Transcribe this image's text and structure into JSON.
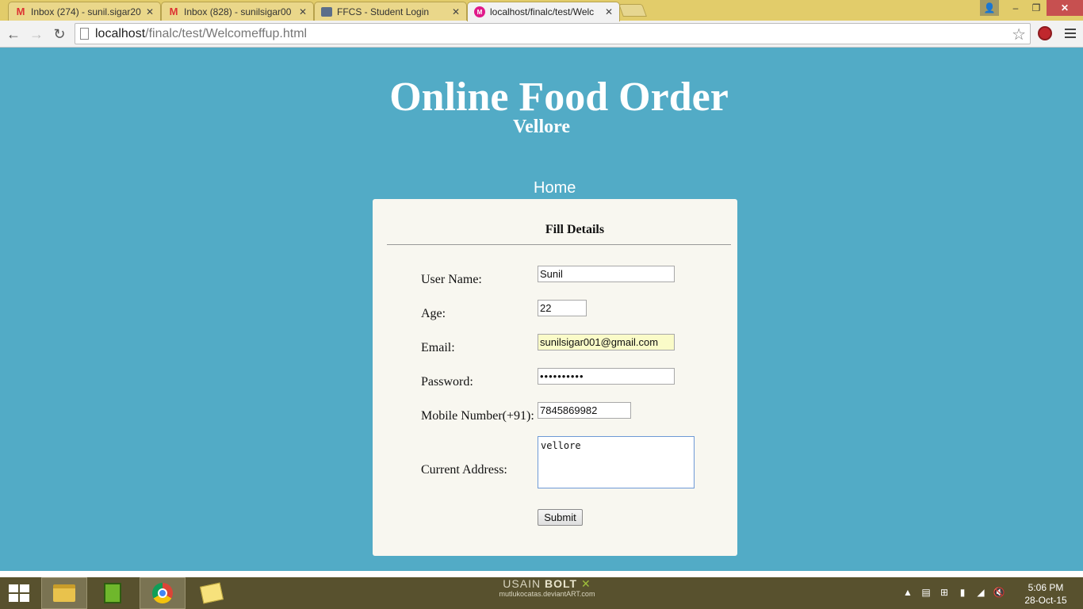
{
  "browser": {
    "tabs": [
      {
        "title": "Inbox (274) - sunil.sigar20",
        "icon": "gmail-icon"
      },
      {
        "title": "Inbox (828) - sunilsigar00",
        "icon": "gmail-icon"
      },
      {
        "title": "FFCS - Student Login",
        "icon": "ffcs-icon"
      },
      {
        "title": "localhost/finalc/test/Welc",
        "icon": "localhost-icon",
        "active": true
      }
    ],
    "tab_close_glyph": "✕",
    "url_host": "localhost",
    "url_path": "/finalc/test/Welcomeffup.html"
  },
  "page": {
    "title": "Online Food Order",
    "subtitle": "Vellore",
    "nav_home": "Home",
    "background_color": "#52abc6"
  },
  "form": {
    "heading": "Fill Details",
    "fields": {
      "username": {
        "label": "User Name:",
        "value": "Sunil"
      },
      "age": {
        "label": "Age:",
        "value": "22"
      },
      "email": {
        "label": "Email:",
        "value": "sunilsigar001@gmail.com"
      },
      "password": {
        "label": "Password:",
        "value": "••••••••••"
      },
      "mobile": {
        "label": "Mobile Number(+91):",
        "value": "7845869982"
      },
      "address": {
        "label": "Current Address:",
        "value": "vellore"
      }
    },
    "submit_label": "Submit"
  },
  "taskbar": {
    "wallpaper_line1": "USAIN",
    "wallpaper_line1_bold": "BOLT",
    "wallpaper_line2": "mutlukocatas.deviantART.com",
    "time": "5:06 PM",
    "date": "28-Oct-15"
  }
}
